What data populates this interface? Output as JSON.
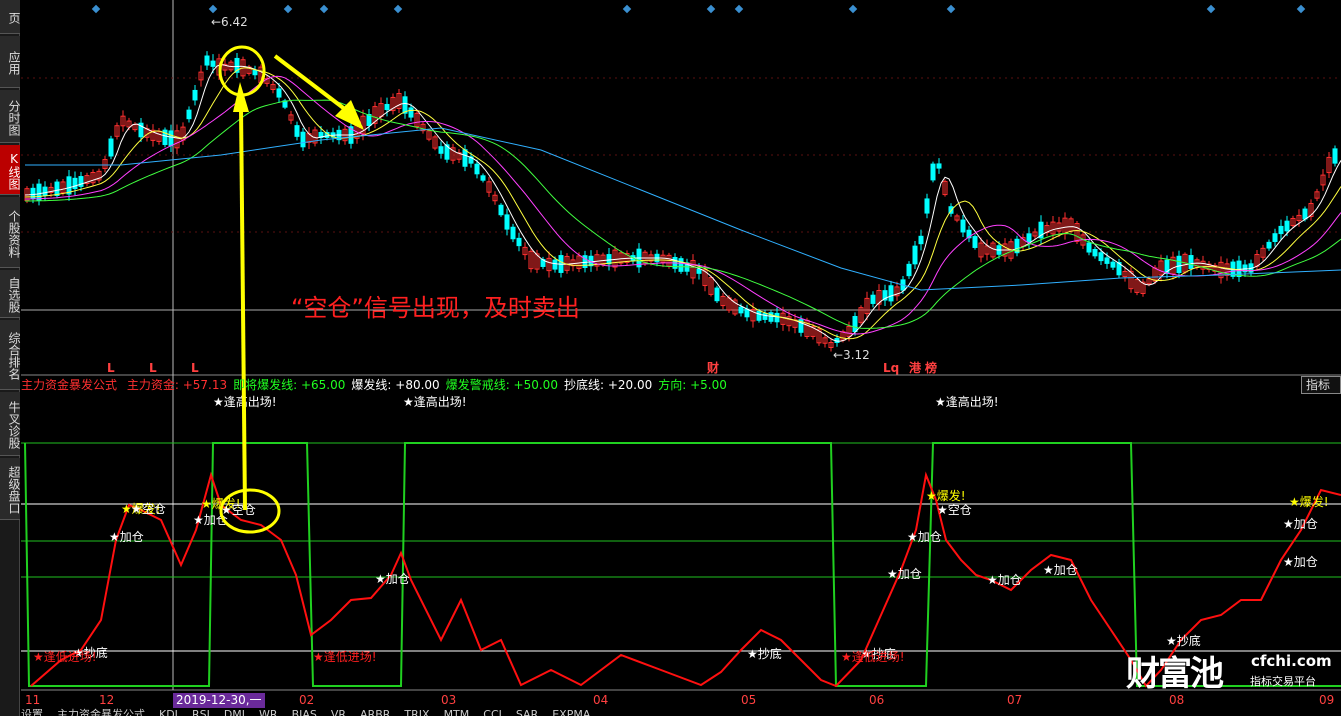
{
  "sidebar": {
    "items": [
      {
        "label": "页",
        "active": false
      },
      {
        "label": "应用",
        "active": false
      },
      {
        "label": "分时图",
        "active": false
      },
      {
        "label": "K线图",
        "active": true
      },
      {
        "label": "个股资料",
        "active": false
      },
      {
        "label": "自选股",
        "active": false
      },
      {
        "label": "综合排名",
        "active": false
      },
      {
        "label": "牛叉诊股",
        "active": false
      },
      {
        "label": "超级盘口",
        "active": false
      }
    ]
  },
  "price_chart": {
    "high_label": "6.42",
    "low_label": "3.12",
    "markers": [
      "L",
      "L",
      "L",
      "财",
      "Lq",
      "港",
      "榜"
    ]
  },
  "annotation": "“空仓”信号出现，及时卖出",
  "indicator": {
    "name": "主力资金暴发公式",
    "items": [
      {
        "label": "主力资金:",
        "value": "+57.13",
        "color": "#ff3030"
      },
      {
        "label": "即将爆发线:",
        "value": "+65.00",
        "color": "#20ff20"
      },
      {
        "label": "爆发线:",
        "value": "+80.00",
        "color": "#ffffff"
      },
      {
        "label": "爆发警戒线:",
        "value": "+50.00",
        "color": "#20ff20"
      },
      {
        "label": "抄底线:",
        "value": "+20.00",
        "color": "#ffffff"
      },
      {
        "label": "方向:",
        "value": "+5.00",
        "color": "#20ff20"
      }
    ],
    "button": "指标说"
  },
  "signals": {
    "top": "★逢高出场!",
    "boom": "★爆发!",
    "empty": "★空仓",
    "add": "★加仓",
    "bottom": "★抄底",
    "low_entry": "★逢低进场!"
  },
  "x_axis": {
    "labels": [
      "11",
      "12",
      "02",
      "03",
      "04",
      "05",
      "06",
      "07",
      "08",
      "09"
    ],
    "date_chip": "2019-12-30,一"
  },
  "logo": {
    "main": "财富池",
    "url": "cfchi.com",
    "sub": "指标交易平台"
  },
  "bottom_tabs": [
    "设置",
    "主力资金暴发公式",
    "KDJ",
    "RSI",
    "DMI",
    "WR",
    "BIAS",
    "VR",
    "ARBR",
    "TRIX",
    "MTM",
    "CCI",
    "SAR",
    "EXPMA"
  ],
  "colors": {
    "up": "#ff3030",
    "down": "#00ffff",
    "signal_line": "#ff1010",
    "state_line": "#20d020",
    "annotation": "#ffff00"
  }
}
